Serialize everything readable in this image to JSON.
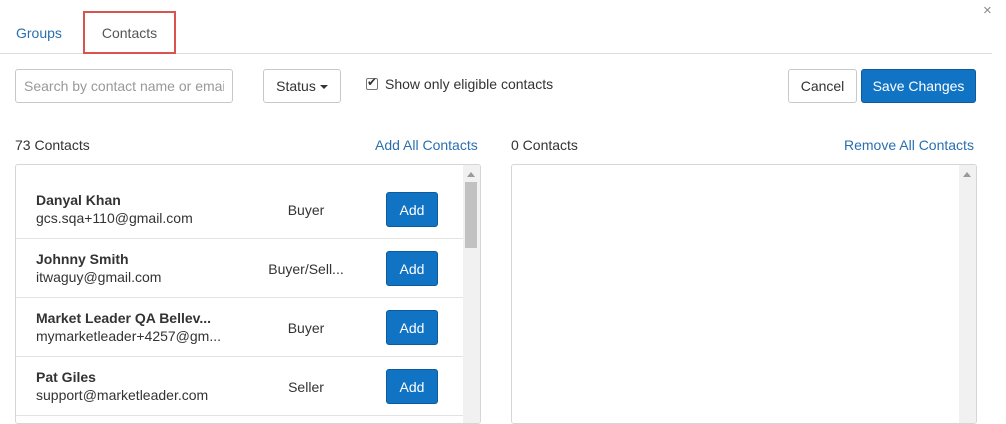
{
  "window": {
    "close_glyph": "×"
  },
  "tabs": [
    {
      "label": "Groups",
      "active": false
    },
    {
      "label": "Contacts",
      "active": true
    }
  ],
  "toolbar": {
    "search_placeholder": "Search by contact name or email",
    "status_label": "Status",
    "eligible_label": "Show only eligible contacts",
    "eligible_checked": true,
    "cancel_label": "Cancel",
    "save_label": "Save Changes"
  },
  "left_panel": {
    "count_label": "73 Contacts",
    "action_label": "Add All Contacts",
    "contacts": [
      {
        "name": "Danyal Khan",
        "email": "gcs.sqa+110@gmail.com",
        "role": "Buyer",
        "button": "Add"
      },
      {
        "name": "Johnny Smith",
        "email": "itwaguy@gmail.com",
        "role": "Buyer/Sell...",
        "button": "Add"
      },
      {
        "name": "Market Leader QA Bellev...",
        "email": "mymarketleader+4257@gm...",
        "role": "Buyer",
        "button": "Add"
      },
      {
        "name": "Pat Giles",
        "email": "support@marketleader.com",
        "role": "Seller",
        "button": "Add"
      }
    ]
  },
  "right_panel": {
    "count_label": "0 Contacts",
    "action_label": "Remove All Contacts",
    "contacts": []
  },
  "colors": {
    "primary": "#1173c3",
    "link": "#2a6fb0",
    "highlight_border": "#d9534f"
  }
}
